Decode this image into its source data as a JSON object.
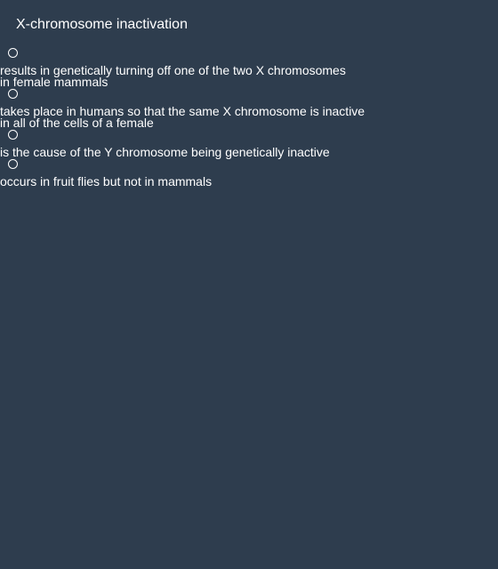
{
  "question": {
    "title": "X-chromosome inactivation"
  },
  "options": [
    {
      "lines": [
        "results in genetically turning off one of the two X chromosomes",
        "in female mammals"
      ],
      "selected": false
    },
    {
      "lines": [
        "takes place in humans so that the same X chromosome is inactive",
        "in all of the cells of a female"
      ],
      "selected": false
    },
    {
      "lines": [
        "is the cause of the Y chromosome being genetically inactive"
      ],
      "selected": false
    },
    {
      "lines": [
        "occurs in fruit flies but not in mammals"
      ],
      "selected": false
    }
  ],
  "colors": {
    "background": "#2e3d4e",
    "text": "#ffffff"
  }
}
